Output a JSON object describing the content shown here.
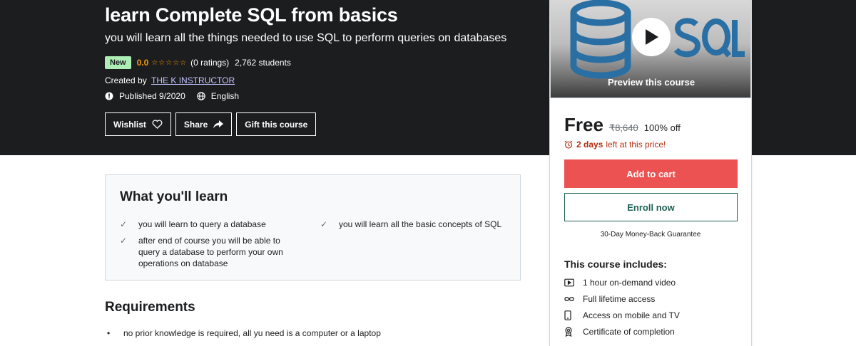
{
  "course": {
    "title": "learn Complete SQL from basics",
    "subtitle": "you will learn all the things needed to use SQL to perform queries on databases",
    "badge": "New",
    "rating": "0.0",
    "stars": "☆☆☆☆☆",
    "ratings_count": "(0 ratings)",
    "students": "2,762 students",
    "created_by_label": "Created by",
    "instructor": "THE K INSTRUCTOR",
    "published": "Published 9/2020",
    "language": "English"
  },
  "actions": {
    "wishlist": "Wishlist",
    "share": "Share",
    "gift": "Gift this course"
  },
  "learn": {
    "heading": "What you'll learn",
    "items": [
      "you will learn to query a database",
      "you will learn all the basic concepts of SQL",
      "after end of course you will be able to query a database to perform your own operations on database"
    ]
  },
  "requirements": {
    "heading": "Requirements",
    "items": [
      "no prior knowledge is required, all yu need is a computer or a laptop"
    ]
  },
  "sidebar": {
    "preview_label": "Preview this course",
    "price": "Free",
    "original_price": "₹8,640",
    "discount": "100% off",
    "deadline_bold": "2 days",
    "deadline_rest": "left at this price!",
    "add_to_cart": "Add to cart",
    "enroll": "Enroll now",
    "guarantee": "30-Day Money-Back Guarantee",
    "includes_title": "This course includes:",
    "includes": [
      {
        "icon": "video-icon",
        "label": "1 hour on-demand video"
      },
      {
        "icon": "infinity-icon",
        "label": "Full lifetime access"
      },
      {
        "icon": "mobile-icon",
        "label": "Access on mobile and TV"
      },
      {
        "icon": "certificate-icon",
        "label": "Certificate of completion"
      }
    ]
  },
  "colors": {
    "hero_bg": "#1c1d1f",
    "accent_red": "#ec5252",
    "enroll_teal": "#1e6055",
    "rating_orange": "#f69c08",
    "badge_green": "#aceeb5",
    "deadline_red": "#b32d0f"
  }
}
